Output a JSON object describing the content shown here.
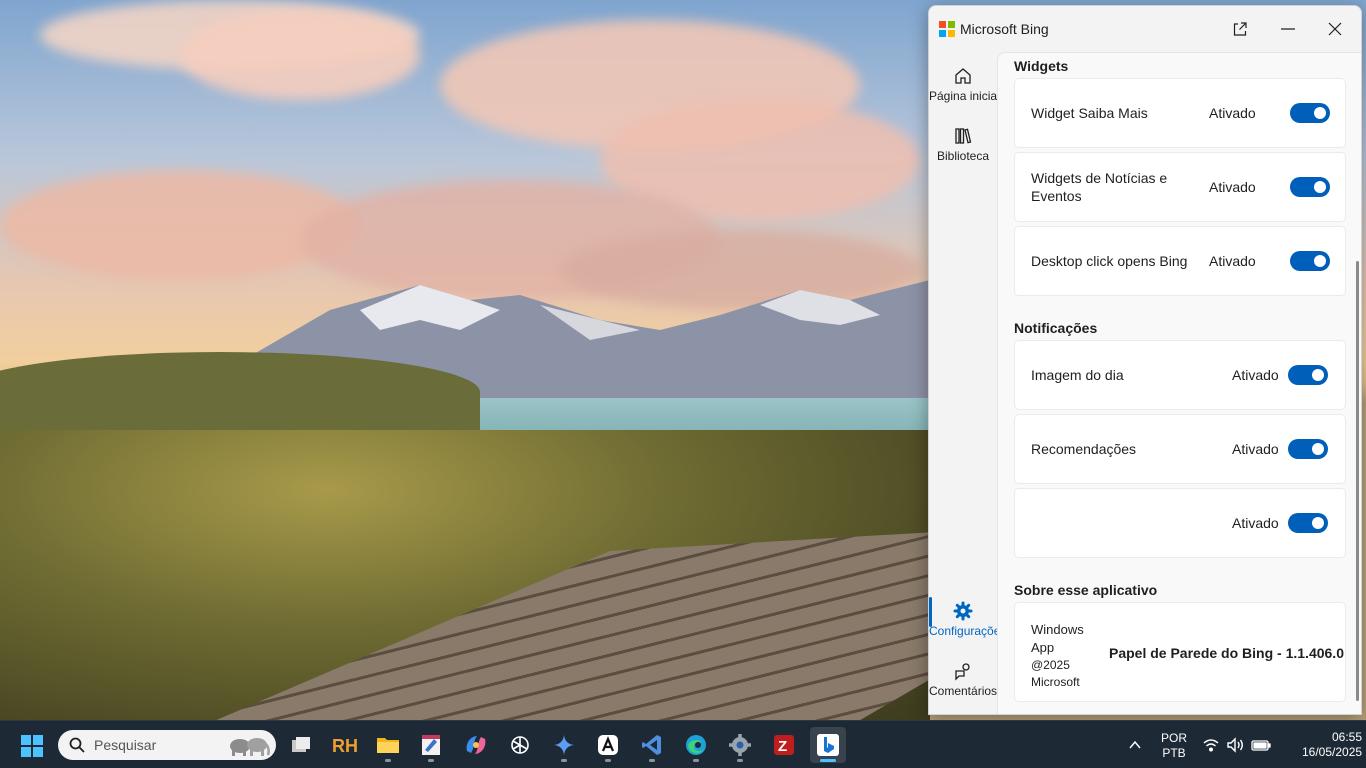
{
  "window": {
    "title": "Microsoft Bing"
  },
  "nav": {
    "home_label": "Página inicial",
    "library_label": "Biblioteca",
    "settings_label": "Configurações",
    "feedback_label": "Comentários"
  },
  "widgets": {
    "title": "Widgets",
    "items": [
      {
        "label": "Widget Saiba Mais",
        "state": "Ativado"
      },
      {
        "label": "Widgets de Notícias e Eventos",
        "state": "Ativado"
      },
      {
        "label": "Desktop click opens Bing",
        "state": "Ativado"
      }
    ]
  },
  "notifications": {
    "title": "Notificações",
    "items": [
      {
        "label": "Imagem do dia",
        "state": "Ativado"
      },
      {
        "label": "Recomendações",
        "state": "Ativado"
      },
      {
        "label": "",
        "state": "Ativado"
      }
    ]
  },
  "about": {
    "title": "Sobre esse aplicativo",
    "line1": "Windows",
    "line2": "App",
    "line3": "@2025",
    "line4": "Microsoft",
    "version": "Papel de Parede do Bing - 1.1.406.0"
  },
  "taskbar": {
    "search_placeholder": "Pesquisar",
    "apps": [
      "task-view",
      "rh",
      "file-explorer",
      "paint",
      "copilot",
      "chatgpt",
      "gemini",
      "app-a",
      "vscode",
      "edge",
      "settings",
      "filezilla",
      "bing"
    ]
  },
  "tray": {
    "lang1": "POR",
    "lang2": "PTB",
    "time": "06:55",
    "date": "16/05/2025"
  },
  "colors": {
    "accent": "#005fb8",
    "taskbar": "#1d2a35"
  }
}
